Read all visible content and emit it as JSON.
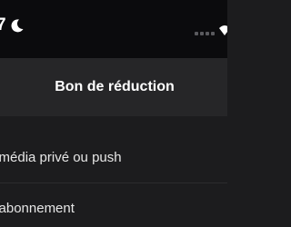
{
  "status_bar": {
    "time_fragment": "7",
    "icons": [
      "moon-icon",
      "signal-icon",
      "wifi-icon"
    ]
  },
  "nav": {
    "title": "Bon de réduction"
  },
  "list": {
    "items": [
      {
        "label": "n média privé ou push"
      },
      {
        "label": "n abonnement"
      }
    ]
  },
  "colors": {
    "status_bar_bg": "#0b0b0d",
    "nav_bg": "#262628",
    "list_bg": "#1c1c1e",
    "text_primary": "#ffffff",
    "text_secondary": "#e6e6e6"
  }
}
